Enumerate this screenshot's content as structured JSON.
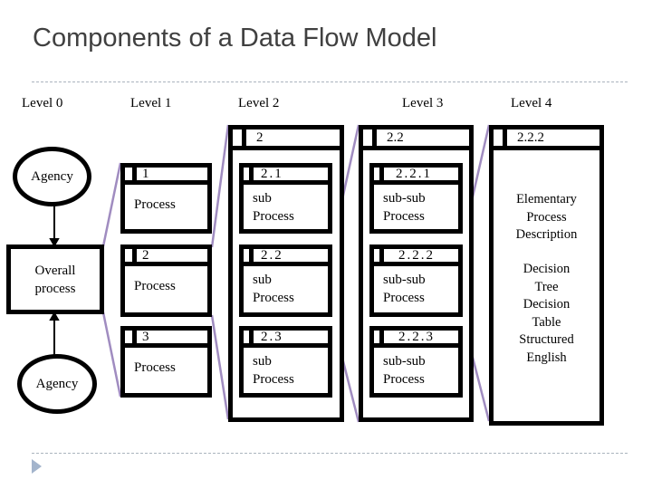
{
  "title": "Components of a Data Flow Model",
  "levels": [
    "Level 0",
    "Level 1",
    "Level 2",
    "Level 3",
    "Level 4"
  ],
  "level0": {
    "top_agency": "Agency",
    "overall_process": "Overall\nprocess",
    "bottom_agency": "Agency"
  },
  "level1": {
    "processes": [
      {
        "number": "1",
        "label": "Process"
      },
      {
        "number": "2",
        "label": "Process"
      },
      {
        "number": "3",
        "label": "Process"
      }
    ]
  },
  "level2": {
    "number": "2",
    "processes": [
      {
        "number": "2.1",
        "label": "sub\nProcess"
      },
      {
        "number": "2.2",
        "label": "sub\nProcess"
      },
      {
        "number": "2.3",
        "label": "sub\nProcess"
      }
    ]
  },
  "level3": {
    "number": "2.2",
    "processes": [
      {
        "number": "2.2.1",
        "label": "sub-sub\nProcess"
      },
      {
        "number": "2.2.2",
        "label": "sub-sub\nProcess"
      },
      {
        "number": "2.2.3",
        "label": "sub-sub\nProcess"
      }
    ]
  },
  "level4": {
    "number": "2.2.2",
    "description": "Elementary\nProcess\nDescription",
    "techniques": "Decision\nTree\nDecision\nTable\nStructured\nEnglish"
  },
  "colors": {
    "title": "#404040",
    "connector": "#a08cc0",
    "divider": "#aab4be",
    "bullet": "#a3b4cc"
  }
}
